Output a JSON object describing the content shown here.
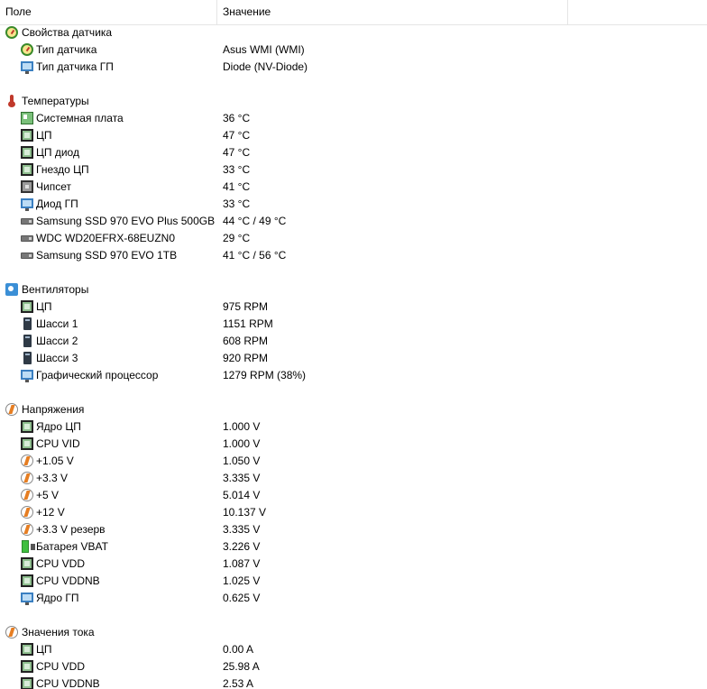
{
  "header": {
    "col_field": "Поле",
    "col_value": "Значение"
  },
  "rows": [
    {
      "kind": "cat",
      "icon": "gauge-icon",
      "label": "Свойства датчика",
      "value": ""
    },
    {
      "kind": "item",
      "icon": "gauge-icon",
      "label": "Тип датчика",
      "value": "Asus WMI  (WMI)"
    },
    {
      "kind": "item",
      "icon": "monitor-icon",
      "label": "Тип датчика ГП",
      "value": "Diode  (NV-Diode)"
    },
    {
      "kind": "blank"
    },
    {
      "kind": "cat",
      "icon": "thermometer-icon",
      "label": "Температуры",
      "value": ""
    },
    {
      "kind": "item",
      "icon": "motherboard-icon",
      "label": "Системная плата",
      "value": "36 °C"
    },
    {
      "kind": "item",
      "icon": "cpu-chip-icon",
      "label": "ЦП",
      "value": "47 °C"
    },
    {
      "kind": "item",
      "icon": "cpu-chip-icon",
      "label": "ЦП диод",
      "value": "47 °C"
    },
    {
      "kind": "item",
      "icon": "cpu-chip-icon",
      "label": "Гнездо ЦП",
      "value": "33 °C"
    },
    {
      "kind": "item",
      "icon": "chipset-icon",
      "label": "Чипсет",
      "value": "41 °C"
    },
    {
      "kind": "item",
      "icon": "monitor-icon",
      "label": "Диод ГП",
      "value": "33 °C"
    },
    {
      "kind": "item",
      "icon": "drive-icon",
      "label": "Samsung SSD 970 EVO Plus 500GB",
      "value": "44 °C / 49 °C"
    },
    {
      "kind": "item",
      "icon": "drive-icon",
      "label": "WDC WD20EFRX-68EUZN0",
      "value": "29 °C"
    },
    {
      "kind": "item",
      "icon": "drive-icon",
      "label": "Samsung SSD 970 EVO 1TB",
      "value": "41 °C / 56 °C"
    },
    {
      "kind": "blank"
    },
    {
      "kind": "cat",
      "icon": "fan-icon",
      "label": "Вентиляторы",
      "value": ""
    },
    {
      "kind": "item",
      "icon": "cpu-chip-icon",
      "label": "ЦП",
      "value": "975 RPM"
    },
    {
      "kind": "item",
      "icon": "tower-case-icon",
      "label": "Шасси 1",
      "value": "1151 RPM"
    },
    {
      "kind": "item",
      "icon": "tower-case-icon",
      "label": "Шасси 2",
      "value": "608 RPM"
    },
    {
      "kind": "item",
      "icon": "tower-case-icon",
      "label": "Шасси 3",
      "value": "920 RPM"
    },
    {
      "kind": "item",
      "icon": "monitor-icon",
      "label": "Графический процессор",
      "value": "1279 RPM  (38%)"
    },
    {
      "kind": "blank"
    },
    {
      "kind": "cat",
      "icon": "bolt-icon",
      "label": "Напряжения",
      "value": ""
    },
    {
      "kind": "item",
      "icon": "cpu-chip-icon",
      "label": "Ядро ЦП",
      "value": "1.000 V"
    },
    {
      "kind": "item",
      "icon": "cpu-chip-icon",
      "label": "CPU VID",
      "value": "1.000 V"
    },
    {
      "kind": "item",
      "icon": "bolt-icon",
      "label": "+1.05 V",
      "value": "1.050 V"
    },
    {
      "kind": "item",
      "icon": "bolt-icon",
      "label": "+3.3 V",
      "value": "3.335 V"
    },
    {
      "kind": "item",
      "icon": "bolt-icon",
      "label": "+5 V",
      "value": "5.014 V"
    },
    {
      "kind": "item",
      "icon": "bolt-icon",
      "label": "+12 V",
      "value": "10.137 V"
    },
    {
      "kind": "item",
      "icon": "bolt-icon",
      "label": "+3.3 V резерв",
      "value": "3.335 V"
    },
    {
      "kind": "item",
      "icon": "battery-icon",
      "label": "Батарея VBAT",
      "value": "3.226 V"
    },
    {
      "kind": "item",
      "icon": "cpu-chip-icon",
      "label": "CPU VDD",
      "value": "1.087 V"
    },
    {
      "kind": "item",
      "icon": "cpu-chip-icon",
      "label": "CPU VDDNB",
      "value": "1.025 V"
    },
    {
      "kind": "item",
      "icon": "monitor-icon",
      "label": "Ядро ГП",
      "value": "0.625 V"
    },
    {
      "kind": "blank"
    },
    {
      "kind": "cat",
      "icon": "bolt-icon",
      "label": "Значения тока",
      "value": ""
    },
    {
      "kind": "item",
      "icon": "cpu-chip-icon",
      "label": "ЦП",
      "value": "0.00 A"
    },
    {
      "kind": "item",
      "icon": "cpu-chip-icon",
      "label": "CPU VDD",
      "value": "25.98 A"
    },
    {
      "kind": "item",
      "icon": "cpu-chip-icon",
      "label": "CPU VDDNB",
      "value": "2.53 A"
    }
  ]
}
